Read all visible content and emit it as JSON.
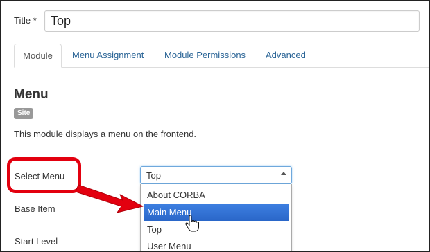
{
  "title_field": {
    "label": "Title *",
    "value": "Top"
  },
  "tabs": [
    {
      "label": "Module",
      "active": true
    },
    {
      "label": "Menu Assignment",
      "active": false
    },
    {
      "label": "Module Permissions",
      "active": false
    },
    {
      "label": "Advanced",
      "active": false
    }
  ],
  "module": {
    "heading": "Menu",
    "badge": "Site",
    "description": "This module displays a menu on the frontend."
  },
  "form": {
    "select_menu_label": "Select Menu",
    "base_item_label": "Base Item",
    "start_level_label": "Start Level",
    "select_menu_value": "Top",
    "options": [
      "About CORBA",
      "Main Menu",
      "Top",
      "User Menu"
    ],
    "highlighted_option": "Main Menu"
  },
  "colors": {
    "link": "#2a6496",
    "callout": "#e3000f",
    "highlight": "#3875d7",
    "badge": "#999999"
  },
  "icons": {
    "select_arrow": "chevron-up-icon",
    "pointer": "hand-pointer-icon",
    "annotation": "red-arrow-icon"
  }
}
